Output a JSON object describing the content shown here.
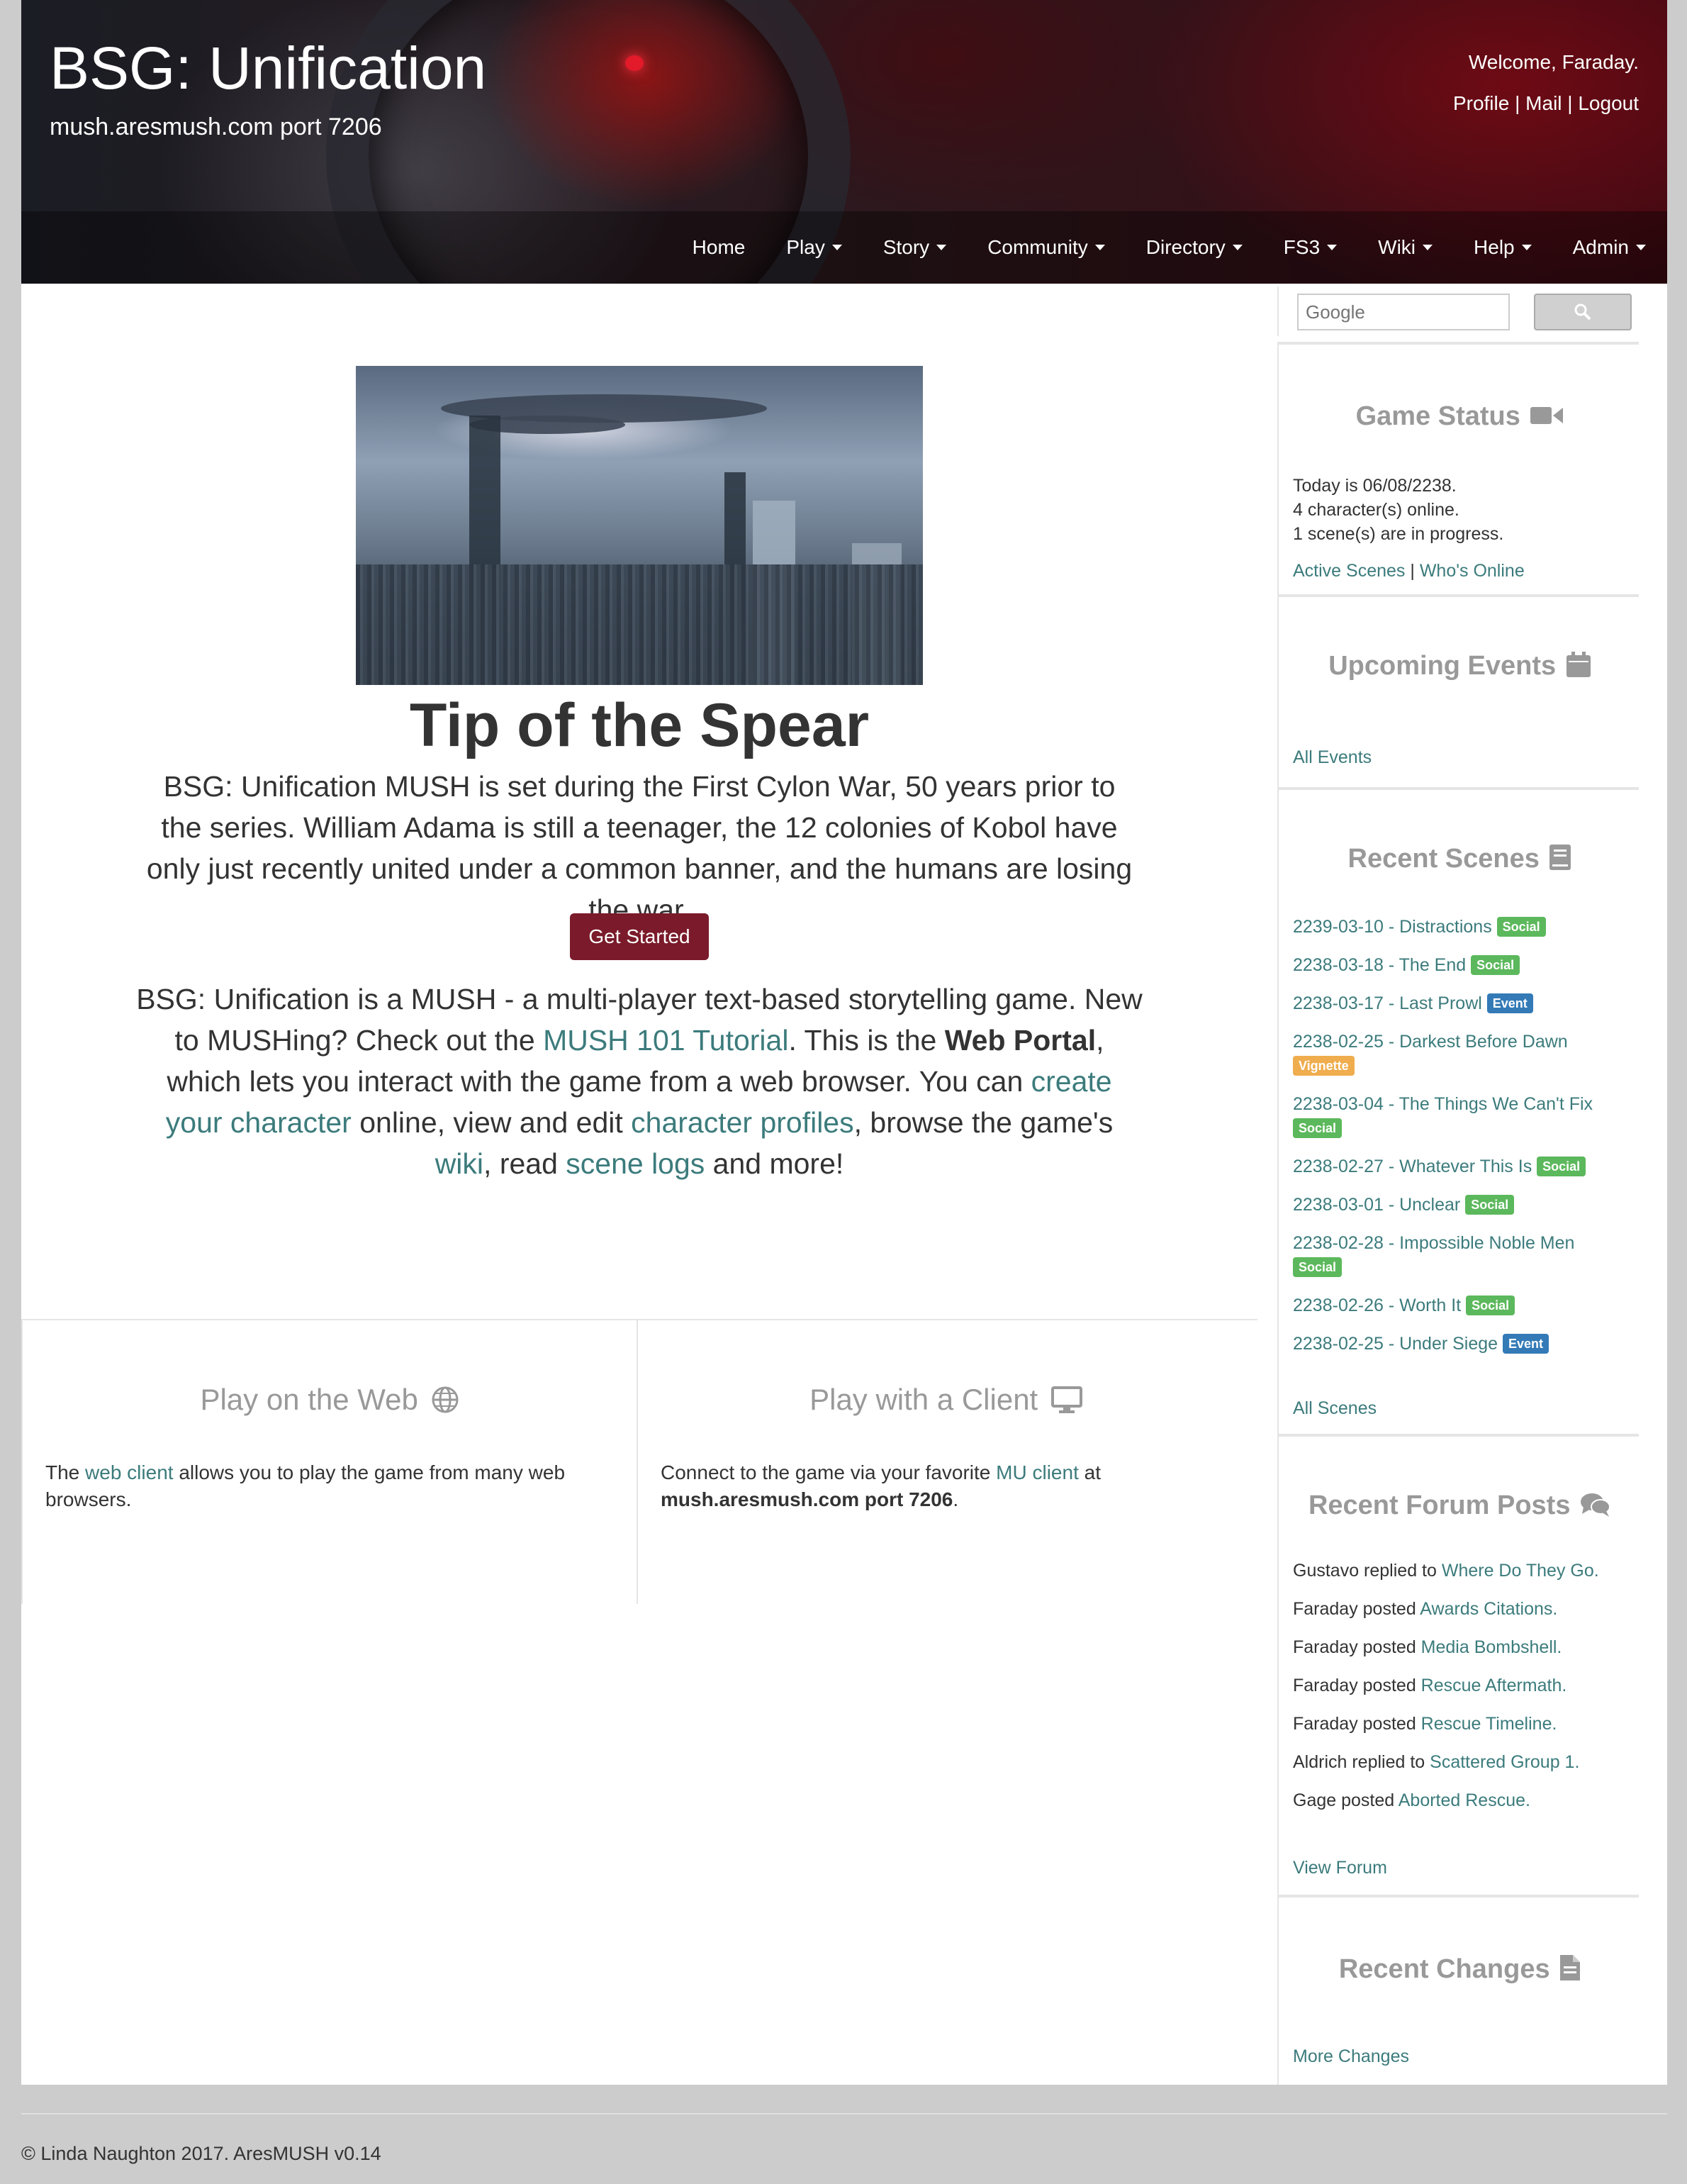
{
  "header": {
    "title": "BSG: Unification",
    "subtitle": "mush.aresmush.com port 7206",
    "welcome": "Welcome, Faraday.",
    "profile": "Profile",
    "mail": "Mail",
    "logout": "Logout",
    "sep": "|"
  },
  "nav": {
    "items": [
      {
        "label": "Home",
        "dropdown": false
      },
      {
        "label": "Play",
        "dropdown": true
      },
      {
        "label": "Story",
        "dropdown": true
      },
      {
        "label": "Community",
        "dropdown": true
      },
      {
        "label": "Directory",
        "dropdown": true
      },
      {
        "label": "FS3",
        "dropdown": true
      },
      {
        "label": "Wiki",
        "dropdown": true
      },
      {
        "label": "Help",
        "dropdown": true
      },
      {
        "label": "Admin",
        "dropdown": true
      }
    ]
  },
  "hero": {
    "title": "Tip of the Spear",
    "text": "BSG: Unification MUSH is set during the First Cylon War, 50 years prior to the series. William Adama is still a teenager, the 12 colonies of Kobol have only just recently united under a common banner, and the humans are losing the war.",
    "button": "Get Started"
  },
  "intro": {
    "t1": "BSG: Unification is a MUSH - a multi-player text-based storytelling game. New to MUSHing? Check out the ",
    "link_tutorial": "MUSH 101 Tutorial",
    "t2": ". This is the ",
    "bold_portal": "Web Portal",
    "t3": ", which lets you interact with the game from a web browser. You can ",
    "link_create": "create your character",
    "t4": " online, view and edit ",
    "link_profiles": "character profiles",
    "t5": ", browse the game's ",
    "link_wiki": "wiki",
    "t6": ", read ",
    "link_logs": "scene logs",
    "t7": " and more!"
  },
  "panels": {
    "web": {
      "title": "Play on the Web",
      "t1": "The ",
      "link": "web client",
      "t2": " allows you to play the game from many web browsers."
    },
    "client": {
      "title": "Play with a Client",
      "t1": "Connect to the game via your favorite ",
      "link": "MU client",
      "t2": " at ",
      "bold": "mush.aresmush.com port 7206",
      "t3": "."
    }
  },
  "search": {
    "placeholder": "Google"
  },
  "game_status": {
    "title": "Game Status",
    "line1": "Today is 06/08/2238.",
    "line2": "4 character(s) online.",
    "line3": "1 scene(s) are in progress.",
    "link_active": "Active Scenes",
    "sep": "|",
    "link_online": "Who's Online"
  },
  "events": {
    "title": "Upcoming Events",
    "link_all": "All Events"
  },
  "scenes": {
    "title": "Recent Scenes",
    "items": [
      {
        "label": "2239-03-10 - Distractions",
        "badge": "Social"
      },
      {
        "label": "2238-03-18 - The End",
        "badge": "Social"
      },
      {
        "label": "2238-03-17 - Last Prowl",
        "badge": "Event"
      },
      {
        "label": "2238-02-25 - Darkest Before Dawn",
        "badge": "Vignette"
      },
      {
        "label": "2238-03-04 - The Things We Can't Fix",
        "badge": "Social"
      },
      {
        "label": "2238-02-27 - Whatever This Is",
        "badge": "Social"
      },
      {
        "label": "2238-03-01 - Unclear",
        "badge": "Social"
      },
      {
        "label": "2238-02-28 - Impossible Noble Men",
        "badge": "Social"
      },
      {
        "label": "2238-02-26 - Worth It",
        "badge": "Social"
      },
      {
        "label": "2238-02-25 - Under Siege",
        "badge": "Event"
      }
    ],
    "link_all": "All Scenes"
  },
  "forum": {
    "title": "Recent Forum Posts",
    "items": [
      {
        "who": "Gustavo replied to ",
        "topic": "Where Do They Go."
      },
      {
        "who": "Faraday posted ",
        "topic": "Awards Citations."
      },
      {
        "who": "Faraday posted ",
        "topic": "Media Bombshell."
      },
      {
        "who": "Faraday posted ",
        "topic": "Rescue Aftermath."
      },
      {
        "who": "Faraday posted ",
        "topic": "Rescue Timeline."
      },
      {
        "who": "Aldrich replied to ",
        "topic": "Scattered Group 1."
      },
      {
        "who": "Gage posted ",
        "topic": "Aborted Rescue."
      }
    ],
    "link_view": "View Forum"
  },
  "changes": {
    "title": "Recent Changes",
    "link_more": "More Changes"
  },
  "footer": {
    "text": "© Linda Naughton 2017. AresMUSH v0.14"
  },
  "colors": {
    "link": "#3c7b7c",
    "button": "#7a1a2a",
    "social": "#5cb85c",
    "event": "#337ab7",
    "vignette": "#f0ad4e"
  }
}
